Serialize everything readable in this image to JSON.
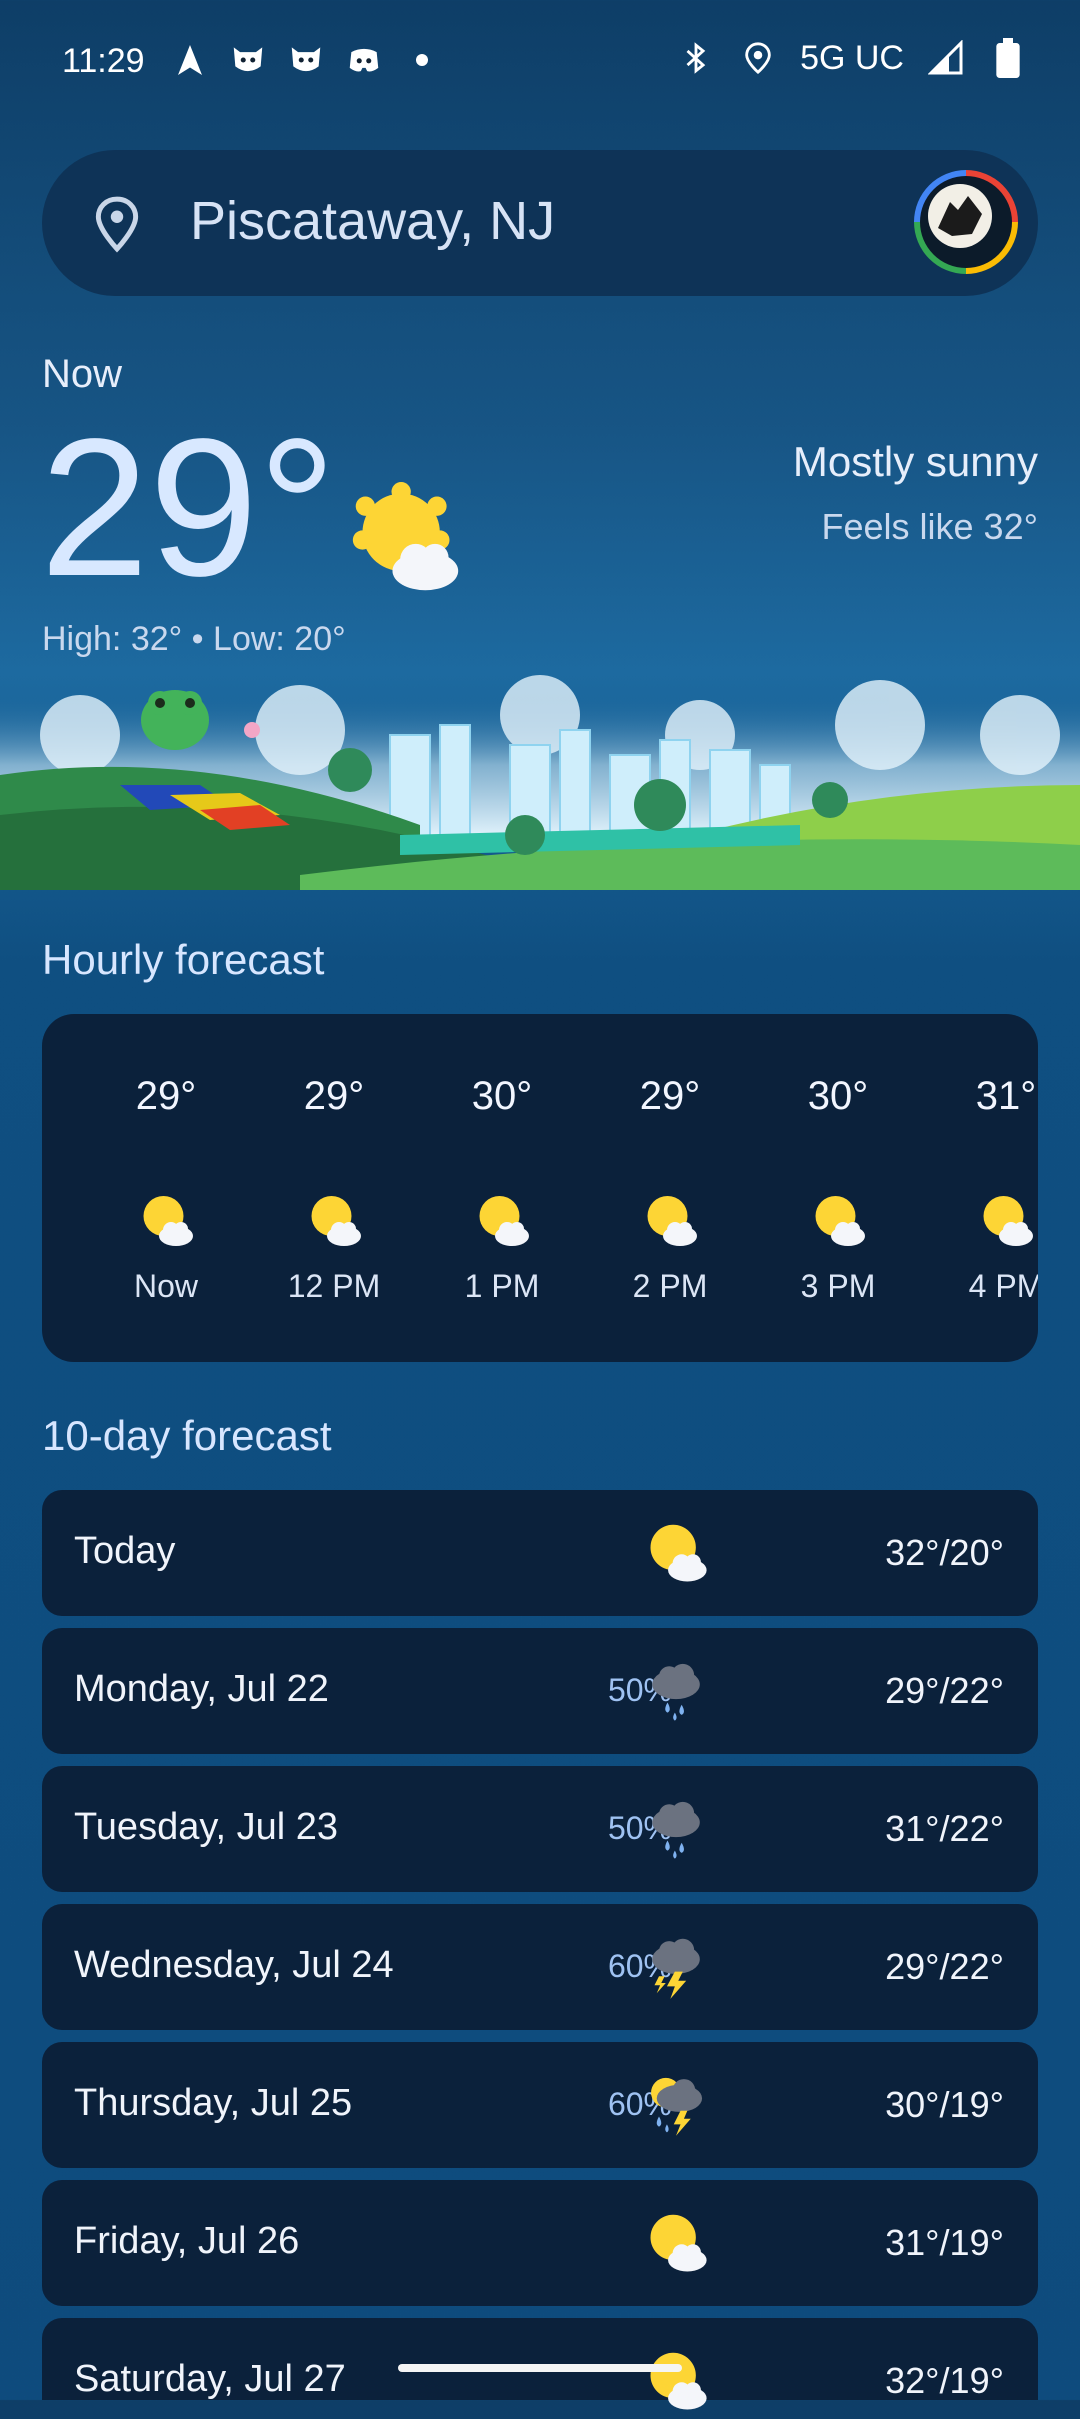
{
  "status_bar": {
    "time": "11:29",
    "network": "5G UC"
  },
  "search": {
    "location": "Piscataway, NJ"
  },
  "current": {
    "label": "Now",
    "temperature": "29°",
    "condition": "Mostly sunny",
    "feels_like": "Feels like 32°",
    "high_low": "High: 32° • Low: 20°"
  },
  "hourly": {
    "title": "Hourly forecast",
    "items": [
      {
        "temp": "29°",
        "label": "Now",
        "icon": "sun-cloud-icon"
      },
      {
        "temp": "29°",
        "label": "12 PM",
        "icon": "sun-cloud-icon"
      },
      {
        "temp": "30°",
        "label": "1 PM",
        "icon": "sun-cloud-icon"
      },
      {
        "temp": "29°",
        "label": "2 PM",
        "icon": "sun-cloud-icon"
      },
      {
        "temp": "30°",
        "label": "3 PM",
        "icon": "sun-cloud-icon"
      },
      {
        "temp": "31°",
        "label": "4 PM",
        "icon": "sun-cloud-icon"
      }
    ]
  },
  "daily": {
    "title": "10-day forecast",
    "items": [
      {
        "day": "Today",
        "precip": "",
        "icon": "sun-cloud-icon",
        "temps": "32°/20°"
      },
      {
        "day": "Monday, Jul 22",
        "precip": "50%",
        "icon": "rain-icon",
        "temps": "29°/22°"
      },
      {
        "day": "Tuesday, Jul 23",
        "precip": "50%",
        "icon": "rain-icon",
        "temps": "31°/22°"
      },
      {
        "day": "Wednesday, Jul 24",
        "precip": "60%",
        "icon": "thunderstorm-icon",
        "temps": "29°/22°"
      },
      {
        "day": "Thursday, Jul 25",
        "precip": "60%",
        "icon": "thunderstorm-rain-icon",
        "temps": "30°/19°"
      },
      {
        "day": "Friday, Jul 26",
        "precip": "",
        "icon": "sun-cloud-icon",
        "temps": "31°/19°"
      },
      {
        "day": "Saturday, Jul 27",
        "precip": "",
        "icon": "sun-cloud-icon",
        "temps": "32°/19°"
      }
    ]
  }
}
